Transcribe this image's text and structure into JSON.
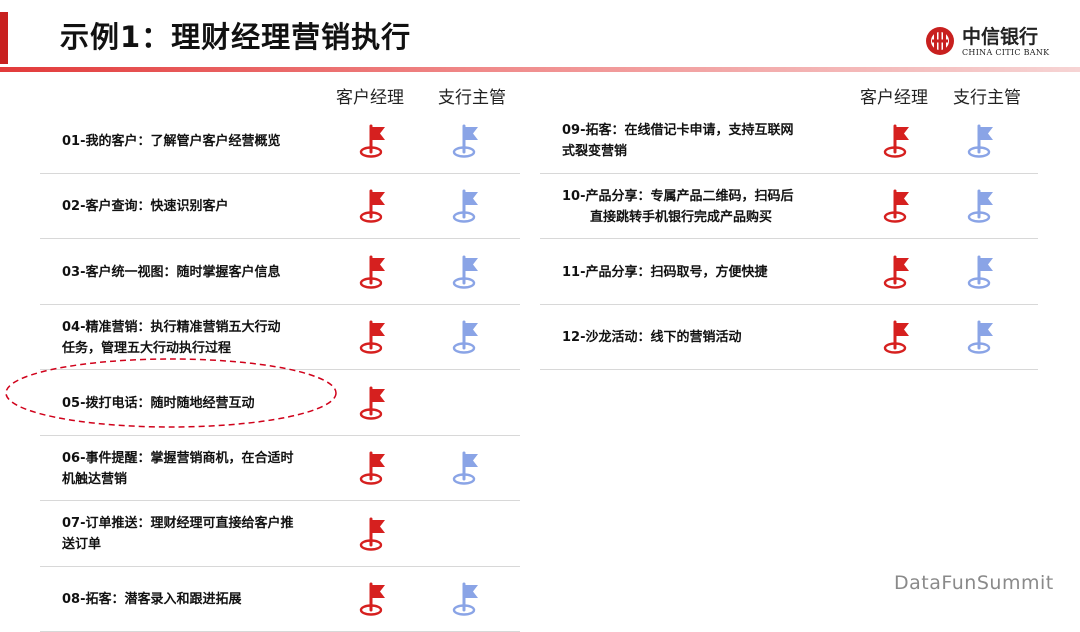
{
  "title": "示例1：理财经理营销执行",
  "colors": {
    "accent_red": "#c8201f",
    "divider_red": "#e23a3a",
    "manager_flag": "#d6201f",
    "supervisor_flag": "#8aa4e6",
    "oval": "#d0021b"
  },
  "logo": {
    "cn": "中信银行",
    "en": "CHINA CITIC BANK",
    "icon": "citic-bank-logo"
  },
  "left_headers": {
    "manager": "客户经理",
    "supervisor": "支行主管"
  },
  "right_headers": {
    "manager": "客户经理",
    "supervisor": "支行主管"
  },
  "left_rows": [
    {
      "lines": [
        "01-我的客户：了解管户客户经营概览"
      ],
      "manager": true,
      "supervisor": true
    },
    {
      "lines": [
        "02-客户查询：快速识别客户"
      ],
      "manager": true,
      "supervisor": true
    },
    {
      "lines": [
        "03-客户统一视图：随时掌握客户信息"
      ],
      "manager": true,
      "supervisor": true
    },
    {
      "lines": [
        "04-精准营销：执行精准营销五大行动",
        "任务，管理五大行动执行过程"
      ],
      "manager": true,
      "supervisor": true
    },
    {
      "lines": [
        "05-拨打电话：随时随地经营互动"
      ],
      "manager": true,
      "supervisor": false,
      "highlighted": true
    },
    {
      "lines": [
        "06-事件提醒：掌握营销商机，在合适时",
        "机触达营销"
      ],
      "manager": true,
      "supervisor": true
    },
    {
      "lines": [
        "07-订单推送：理财经理可直接给客户推",
        "送订单"
      ],
      "manager": true,
      "supervisor": false
    },
    {
      "lines": [
        "08-拓客：潜客录入和跟进拓展"
      ],
      "manager": true,
      "supervisor": true
    }
  ],
  "right_rows": [
    {
      "lines": [
        "09-拓客：在线借记卡申请，支持互联网",
        "式裂变营销"
      ],
      "manager": true,
      "supervisor": true
    },
    {
      "lines": [
        "10-产品分享：专属产品二维码，扫码后",
        "直接跳转手机银行完成产品购买"
      ],
      "manager": true,
      "supervisor": true
    },
    {
      "lines": [
        "11-产品分享：扫码取号，方便快捷"
      ],
      "manager": true,
      "supervisor": true
    },
    {
      "lines": [
        "12-沙龙活动：线下的营销活动"
      ],
      "manager": true,
      "supervisor": true
    }
  ],
  "watermark": "DataFunSummit"
}
